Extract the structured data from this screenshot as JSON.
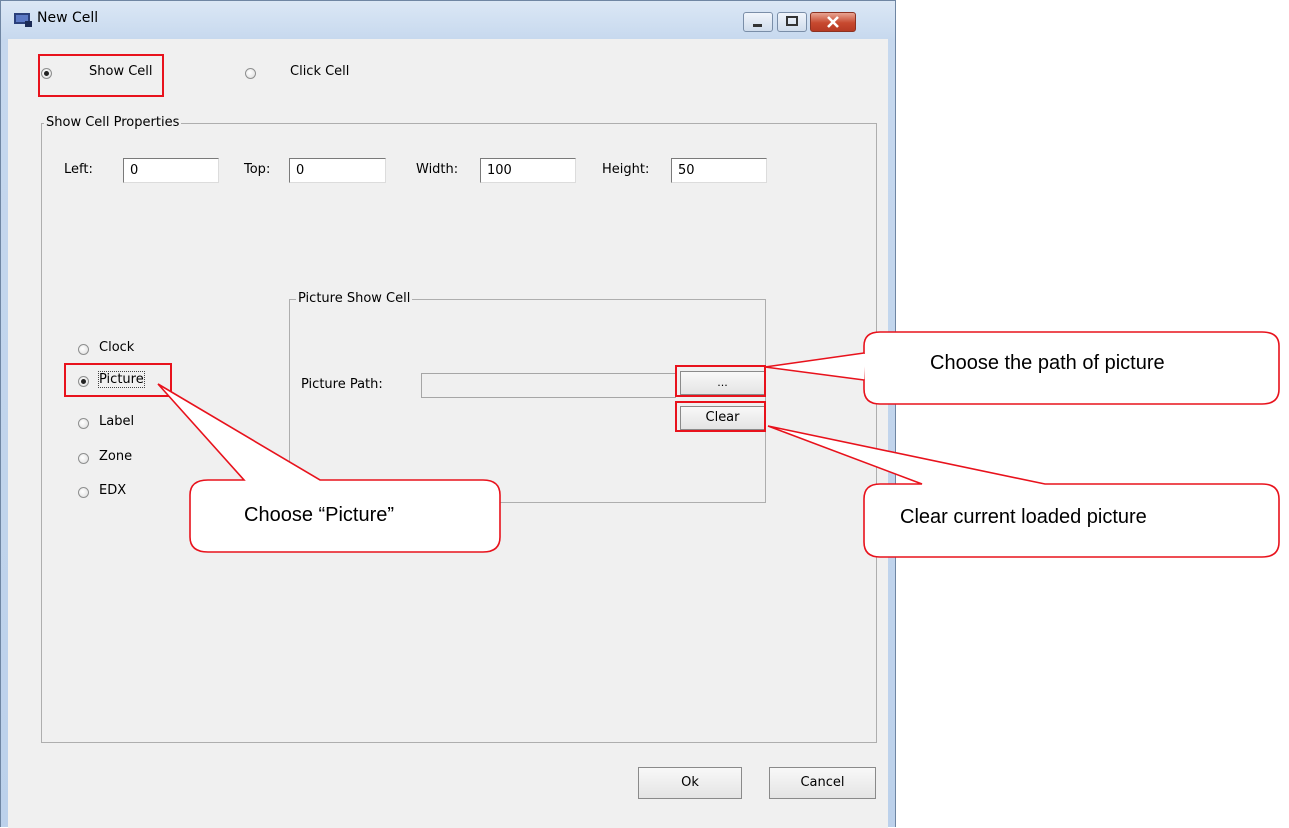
{
  "window": {
    "title": "New Cell",
    "controls": {
      "minimize": "minimize",
      "maximize": "maximize",
      "close": "close"
    }
  },
  "mode": {
    "show_cell_label": "Show Cell",
    "click_cell_label": "Click Cell",
    "selected": "Show Cell"
  },
  "properties": {
    "group_title": "Show Cell Properties",
    "left_label": "Left:",
    "left_value": "0",
    "top_label": "Top:",
    "top_value": "0",
    "width_label": "Width:",
    "width_value": "100",
    "height_label": "Height:",
    "height_value": "50"
  },
  "cell_types": {
    "items": [
      "Clock",
      "Picture",
      "Label",
      "Zone",
      "EDX"
    ],
    "selected": "Picture"
  },
  "picture_group": {
    "title": "Picture Show Cell",
    "path_label": "Picture Path:",
    "path_value": "",
    "browse_label": "...",
    "clear_label": "Clear"
  },
  "footer": {
    "ok_label": "Ok",
    "cancel_label": "Cancel"
  },
  "annotations": {
    "choose_picture": "Choose “Picture”",
    "choose_path": "Choose the path of picture",
    "clear_picture": "Clear current loaded picture",
    "highlight_color": "#e8121c"
  }
}
